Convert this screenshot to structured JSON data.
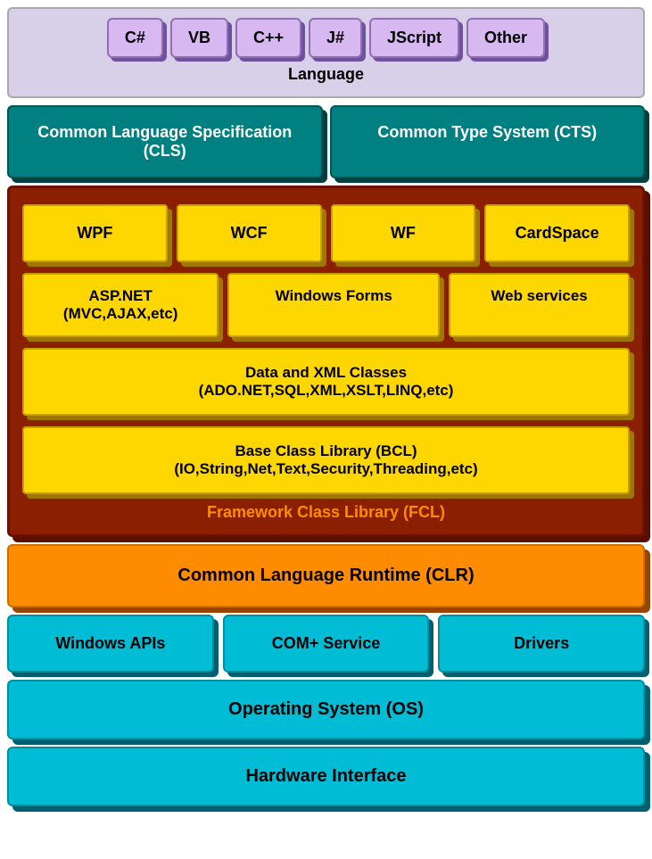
{
  "language": {
    "label": "Language",
    "chips": [
      "C#",
      "VB",
      "C++",
      "J#",
      "JScript",
      "Other"
    ]
  },
  "cls": "Common Language Specification (CLS)",
  "cts": "Common Type System (CTS)",
  "fcl": {
    "label": "Framework Class Library (FCL)",
    "row1": [
      "WPF",
      "WCF",
      "WF",
      "CardSpace"
    ],
    "aspnet": "ASP.NET\n(MVC,AJAX,etc)",
    "winforms": "Windows Forms",
    "webservices": "Web services",
    "dataxml_line1": "Data and XML Classes",
    "dataxml_line2": "(ADO.NET,SQL,XML,XSLT,LINQ,etc)",
    "bcl_line1": "Base Class Library (BCL)",
    "bcl_line2": "(IO,String,Net,Text,Security,Threading,etc)"
  },
  "clr": "Common Language Runtime (CLR)",
  "apis": [
    "Windows APIs",
    "COM+ Service",
    "Drivers"
  ],
  "os": "Operating System (OS)",
  "hardware": "Hardware Interface"
}
